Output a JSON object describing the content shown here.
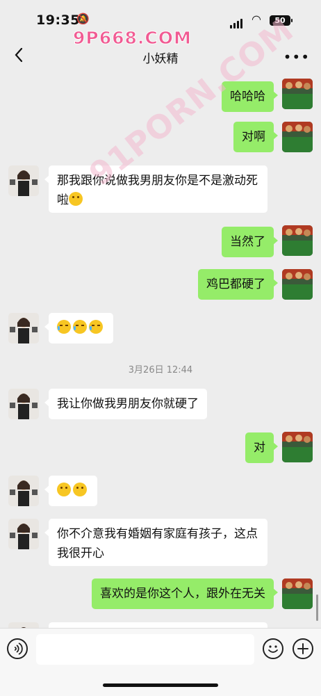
{
  "status": {
    "time": "19:35",
    "battery": "50"
  },
  "watermarks": {
    "top": "9P668.COM",
    "diagonal": "91PORN.COM"
  },
  "chat": {
    "title": "小妖精"
  },
  "messages": [
    {
      "from": "me",
      "text": "哈哈哈"
    },
    {
      "from": "me",
      "text": "对啊"
    },
    {
      "from": "her",
      "text": "那我跟你说做我男朋友你是不是激动死啦",
      "emojis": [
        "thinking"
      ]
    },
    {
      "from": "me",
      "text": "当然了"
    },
    {
      "from": "me",
      "text": "鸡巴都硬了"
    },
    {
      "from": "her",
      "text": "",
      "emojis": [
        "crying-laughing",
        "crying-laughing",
        "crying-laughing"
      ]
    },
    {
      "from": "her",
      "text": "我让你做我男朋友你就硬了"
    },
    {
      "from": "me",
      "text": "对"
    },
    {
      "from": "her",
      "text": "",
      "emojis": [
        "thinking",
        "thinking"
      ]
    },
    {
      "from": "her",
      "text": "你不介意我有婚姻有家庭有孩子，这点我很开心"
    },
    {
      "from": "me",
      "text": "喜欢的是你这个人，跟外在无关"
    }
  ],
  "timestamp": "3月26日 12:44",
  "icons": {
    "back": "chevron-left-icon",
    "more": "more-dots-icon",
    "voice": "voice-icon",
    "emoji": "smile-icon",
    "plus": "plus-icon"
  },
  "colors": {
    "my_bubble": "#95ec69",
    "her_bubble": "#ffffff",
    "background": "#ededed"
  }
}
